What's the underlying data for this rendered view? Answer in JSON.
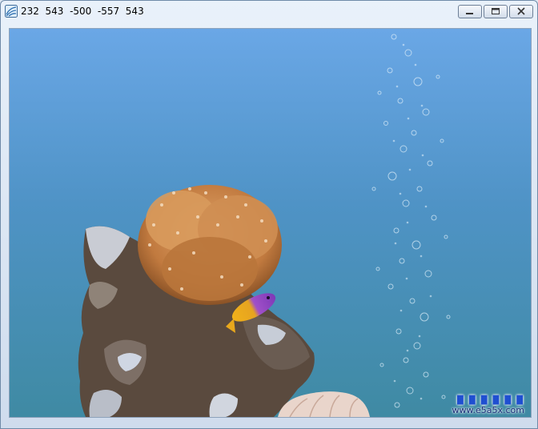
{
  "window": {
    "title": "232  543  -500  -557  543",
    "minimize_icon": "minimize-icon",
    "maximize_icon": "maximize-icon",
    "close_icon": "close-icon"
  },
  "scene": {
    "objects": [
      "rock-formation",
      "soft-coral",
      "purple-yellow-fish",
      "bubble-column",
      "white-coral"
    ]
  },
  "watermark": {
    "line1": "█ █ █ █ █ █",
    "line2": "www.e5a5x.com"
  }
}
